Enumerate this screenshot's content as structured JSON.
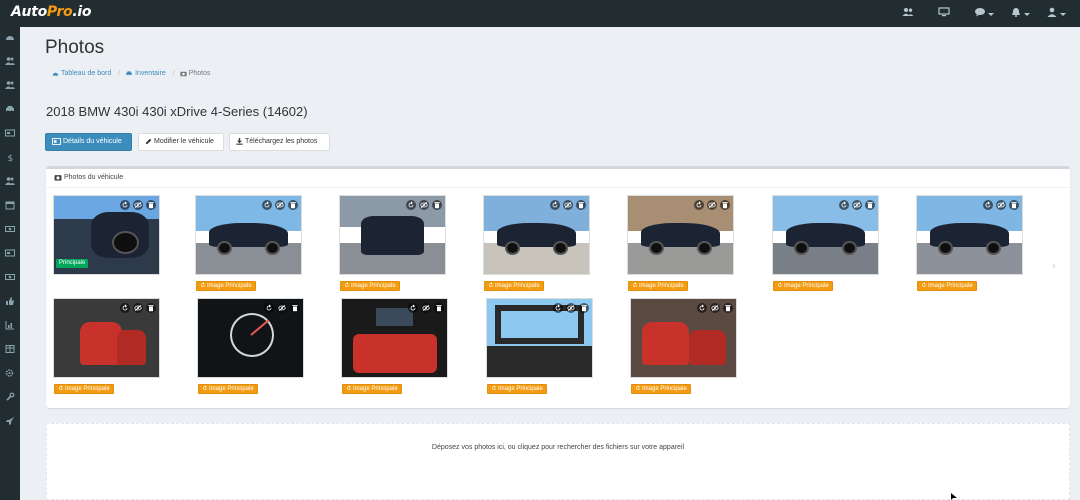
{
  "app": {
    "logo_part1": "Auto",
    "logo_part2": "Pro",
    "logo_part3": ".io"
  },
  "topbar": {
    "icons": [
      "users-icon",
      "monitor-icon",
      "chat-icon",
      "bell-icon",
      "user-icon"
    ]
  },
  "sidebar": {
    "icons": [
      "dashboard-icon",
      "users-icon",
      "users-icon",
      "car-icon",
      "id-card-icon",
      "dollar-icon",
      "users-icon",
      "calendar-icon",
      "money-icon",
      "id-card-icon",
      "money-icon",
      "thumbs-up-icon",
      "chart-icon",
      "table-icon",
      "gear-icon",
      "wrench-icon",
      "rocket-icon"
    ]
  },
  "page": {
    "title": "Photos"
  },
  "breadcrumb": {
    "home": "Tableau de bord",
    "inventory": "Inventaire",
    "current": "Photos"
  },
  "vehicle": {
    "title": "2018 BMW 430i 430i xDrive 4-Series (14602)"
  },
  "toolbar": {
    "details": "Détails du véhicule",
    "edit": "Modifier le véhicule",
    "download": "Téléchargez les photos"
  },
  "photos_box": {
    "title": "Photos du véhicule",
    "principal_badge": "Principale",
    "main_image_label": "Image Principale"
  },
  "dropzone": {
    "text": "Déposez vos photos ici, ou cliquez pour rechercher des fichiers sur votre appareil"
  },
  "colors": {
    "topbar": "#222d32",
    "primary": "#3c8dbc",
    "warning": "#f39c12",
    "success": "#00a65a"
  }
}
